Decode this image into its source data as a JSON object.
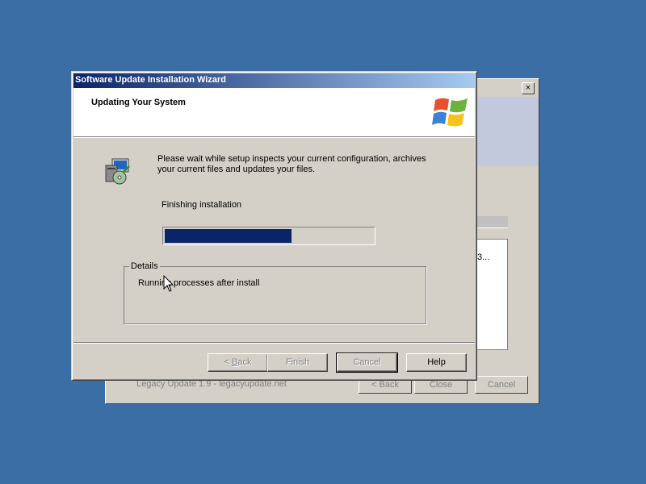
{
  "background_window": {
    "close_glyph": "×",
    "list_text_fragment": "3...",
    "footer_text": "Legacy Update 1.9 - legacyupdate.net",
    "buttons": {
      "back": "< Back",
      "close": "Close",
      "cancel": "Cancel"
    }
  },
  "wizard": {
    "title": "Software Update Installation Wizard",
    "header_title": "Updating Your System",
    "intro_text": "Please wait while setup inspects your current configuration, archives your current files and updates your files.",
    "status_text": "Finishing installation",
    "progress_fraction": 0.61,
    "details_label": "Details",
    "details_text": "Running processes after install",
    "buttons": {
      "back_prefix": "< ",
      "back_accel": "B",
      "back_rest": "ack",
      "finish": "Finish",
      "cancel": "Cancel",
      "help": "Help"
    }
  },
  "colors": {
    "desktop": "#3a6ea5",
    "title_gradient_start": "#0a246a",
    "title_gradient_end": "#a6caf0",
    "progress_fill": "#0a246a",
    "window_face": "#d4d0c8"
  },
  "icons": [
    "windows-logo-icon",
    "setup-installer-icon",
    "mouse-pointer-icon",
    "close-icon"
  ]
}
